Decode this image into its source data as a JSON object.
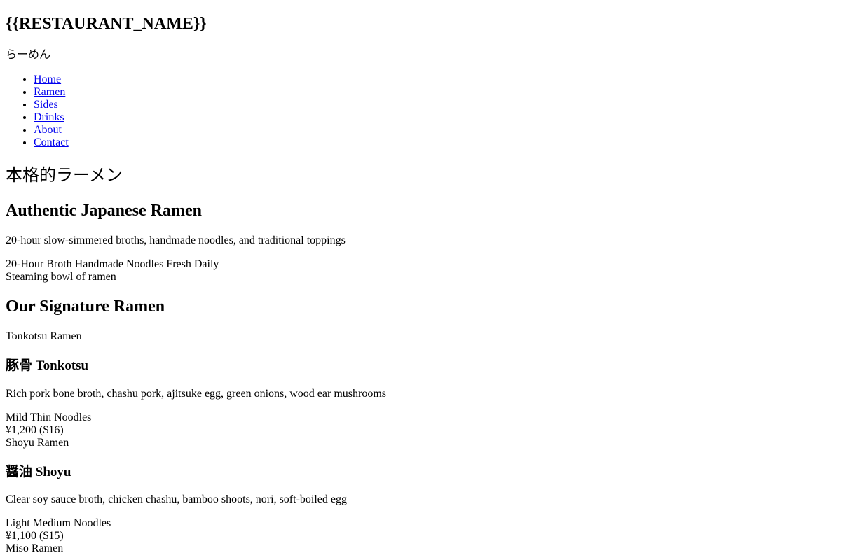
{
  "header": {
    "restaurant_name": "{{RESTAURANT_NAME}}",
    "tagline": "らーめん"
  },
  "nav": {
    "items": [
      {
        "label": "Home"
      },
      {
        "label": "Ramen"
      },
      {
        "label": "Sides"
      },
      {
        "label": "Drinks"
      },
      {
        "label": "About"
      },
      {
        "label": "Contact"
      }
    ]
  },
  "hero": {
    "title_jp": "本格的ラーメン",
    "title": "Authentic Japanese Ramen",
    "description": "20-hour slow-simmered broths, handmade noodles, and traditional toppings",
    "features": [
      "20-Hour Broth",
      "Handmade Noodles",
      "Fresh Daily"
    ],
    "image_alt": "Steaming bowl of ramen"
  },
  "menu": {
    "section_title": "Our Signature Ramen",
    "dishes": [
      {
        "image_alt": "Tonkotsu Ramen",
        "name": "豚骨 Tonkotsu",
        "description": "Rich pork bone broth, chashu pork, ajitsuke egg, green onions, wood ear mushrooms",
        "tags": [
          "Mild",
          "Thin Noodles"
        ],
        "price": "¥1,200 ($16)"
      },
      {
        "image_alt": "Shoyu Ramen",
        "name": "醤油 Shoyu",
        "description": "Clear soy sauce broth, chicken chashu, bamboo shoots, nori, soft-boiled egg",
        "tags": [
          "Light",
          "Medium Noodles"
        ],
        "price": "¥1,100 ($15)"
      },
      {
        "image_alt": "Miso Ramen"
      }
    ]
  }
}
